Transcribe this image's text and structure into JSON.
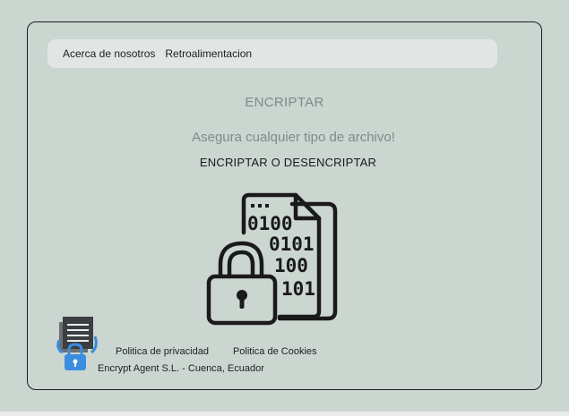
{
  "nav": {
    "about": "Acerca de nosotros",
    "feedback": "Retroalimentacion"
  },
  "main": {
    "title": "ENCRIPTAR",
    "subtitle": "Asegura cualquier tipo de archivo!",
    "action_label": "ENCRIPTAR O DESENCRIPTAR",
    "hero_icon": "binary-file-padlock-icon",
    "binary_lines": [
      "0100",
      "0101",
      "100",
      "101"
    ]
  },
  "footer": {
    "logo_icon": "encrypt-agent-logo-icon",
    "privacy": "Politica de privacidad",
    "cookies": "Politica de Cookies",
    "company": "Encrypt Agent S.L. - Cuenca, Ecuador"
  },
  "colors": {
    "background": "#ccd6d1",
    "navbar": "#e1e6e4",
    "muted_text": "#7f8b87",
    "dark": "#1a1a1a",
    "logo_blue": "#3a8de0"
  }
}
